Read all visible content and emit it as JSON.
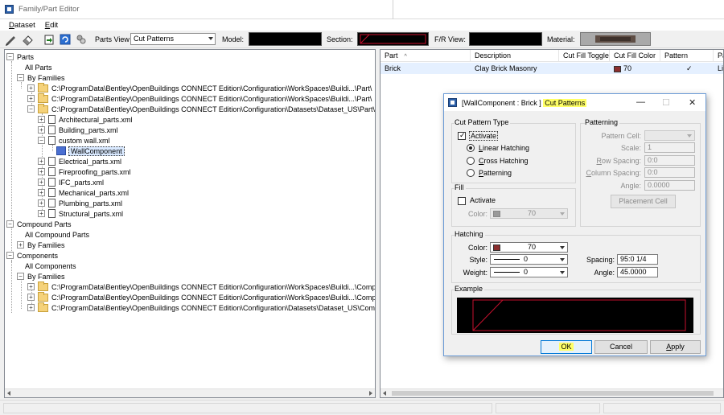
{
  "window": {
    "title": "Family/Part Editor"
  },
  "menu": {
    "items": [
      "Dataset",
      "Edit"
    ]
  },
  "toolbar": {
    "parts_view_label": "Parts View",
    "parts_view_value": "Cut Patterns",
    "model_label": "Model:",
    "section_label": "Section:",
    "fr_view_label": "F/R View:",
    "material_label": "Material:"
  },
  "tree": {
    "parts": "Parts",
    "all_parts": "All Parts",
    "by_families": "By Families",
    "families": [
      "C:\\ProgramData\\Bentley\\OpenBuildings CONNECT Edition\\Configuration\\WorkSpaces\\Buildi...\\Part\\",
      "C:\\ProgramData\\Bentley\\OpenBuildings CONNECT Edition\\Configuration\\WorkSpaces\\Buildi...\\Part\\",
      "C:\\ProgramData\\Bentley\\OpenBuildings CONNECT Edition\\Configuration\\Datasets\\Dataset_US\\Part\\"
    ],
    "files": [
      "Architectural_parts.xml",
      "Building_parts.xml",
      "custom wall.xml",
      "Electrical_parts.xml",
      "Fireproofing_parts.xml",
      "IFC_parts.xml",
      "Mechanical_parts.xml",
      "Plumbing_parts.xml",
      "Structural_parts.xml"
    ],
    "wall_component": "WallComponent",
    "compound_parts": "Compound Parts",
    "all_compound_parts": "All Compound Parts",
    "compound_by_families": "By Families",
    "components": "Components",
    "all_components": "All Components",
    "components_by_families": "By Families",
    "component_families": [
      "C:\\ProgramData\\Bentley\\OpenBuildings CONNECT Edition\\Configuration\\WorkSpaces\\Buildi...\\Comp\\",
      "C:\\ProgramData\\Bentley\\OpenBuildings CONNECT Edition\\Configuration\\WorkSpaces\\Buildi...\\Comp\\",
      "C:\\ProgramData\\Bentley\\OpenBuildings CONNECT Edition\\Configuration\\Datasets\\Dataset_US\\Comp\\"
    ]
  },
  "grid": {
    "headers": [
      "Part",
      "Description",
      "Cut Fill Toggle",
      "Cut Fill Color",
      "Pattern",
      "Pat"
    ],
    "row": {
      "part": "Brick",
      "description": "Clay Brick Masonry",
      "cut_fill_color": "70",
      "pattern": "✓",
      "pat": "Lin"
    }
  },
  "dialog": {
    "title_prefix": "[WallComponent : Brick ]",
    "title_highlight": "Cut Patterns",
    "cut_pattern_type": {
      "title": "Cut Pattern Type",
      "activate": "Activate",
      "linear": "Linear Hatching",
      "cross": "Cross Hatching",
      "patterning": "Patterning"
    },
    "patterning": {
      "title": "Patterning",
      "pattern_cell_label": "Pattern Cell:",
      "scale_label": "Scale:",
      "scale_value": "1",
      "row_spacing_label": "Row Spacing:",
      "row_spacing_value": "0:0",
      "column_spacing_label": "Column Spacing:",
      "column_spacing_value": "0:0",
      "angle_label": "Angle:",
      "angle_value": "0.0000",
      "placement_cell": "Placement Cell"
    },
    "fill": {
      "title": "Fill",
      "activate": "Activate",
      "color_label": "Color:",
      "color_value": "70"
    },
    "hatching": {
      "title": "Hatching",
      "color_label": "Color:",
      "color_value": "70",
      "style_label": "Style:",
      "style_value": "0",
      "weight_label": "Weight:",
      "weight_value": "0",
      "spacing_label": "Spacing:",
      "spacing_value": "95:0 1/4",
      "angle_label": "Angle:",
      "angle_value": "45.0000"
    },
    "example": {
      "title": "Example"
    },
    "buttons": {
      "ok": "OK",
      "cancel": "Cancel",
      "apply": "Apply"
    }
  },
  "colors": {
    "brick_red": "#8b2e2e",
    "highlight": "#ffff66",
    "selection": "#e5f0ff",
    "accent": "#0078d7"
  }
}
